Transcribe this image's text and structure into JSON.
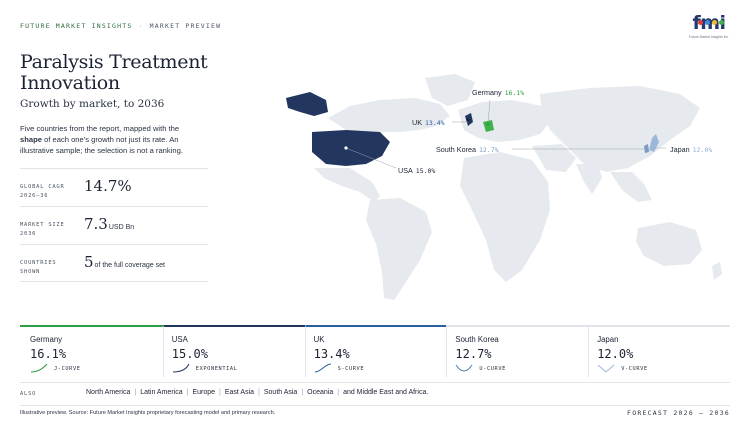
{
  "header": {
    "brand": "FUTURE MARKET INSIGHTS",
    "separator": "·",
    "section": "MARKET PREVIEW"
  },
  "logo": {
    "text": "fmi",
    "tagline": "Future Market Insights Inc.",
    "dot_colors": [
      "#e23b3b",
      "#3a8fe0",
      "#f2b632",
      "#3fb34a"
    ]
  },
  "title": "Paralysis Treatment Innovation",
  "subtitle": "Growth by market, to 2036",
  "description": {
    "before": "Five countries from the report, mapped with the ",
    "bold": "shape",
    "after": " of each one's growth not just its rate. An illustrative sample; the selection is not a ranking."
  },
  "stats": [
    {
      "label": "GLOBAL CAGR 2026–36",
      "value": "14.7%",
      "unit": ""
    },
    {
      "label": "MARKET SIZE 2036",
      "value": "7.3",
      "unit": "USD Bn"
    },
    {
      "label": "COUNTRIES SHOWN",
      "value": "5",
      "unit": "of the full coverage set"
    }
  ],
  "map": {
    "labels": [
      {
        "name": "Germany",
        "value": "16.1%",
        "color": "#2e9e45"
      },
      {
        "name": "UK",
        "value": "13.4%",
        "color": "#2a5e9c"
      },
      {
        "name": "South Korea",
        "value": "12.7%",
        "color": "#7a9bc2"
      },
      {
        "name": "Japan",
        "value": "12.0%",
        "color": "#8fb0d4"
      },
      {
        "name": "USA",
        "value": "15.0%",
        "color": "#1a2233"
      }
    ],
    "colors": {
      "land": "#e6e9ed",
      "usa": "#23365f",
      "germany": "#3fb34a",
      "uk": "#23365f",
      "accent_light": "#9bb8dc"
    }
  },
  "cards": [
    {
      "name": "Germany",
      "value": "16.1%",
      "shape": "J-CURVE",
      "accent": "#2e9e45"
    },
    {
      "name": "USA",
      "value": "15.0%",
      "shape": "EXPONENTIAL",
      "accent": "#23365f"
    },
    {
      "name": "UK",
      "value": "13.4%",
      "shape": "S-CURVE",
      "accent": "#2a5e9c"
    },
    {
      "name": "South Korea",
      "value": "12.7%",
      "shape": "U-CURVE",
      "accent": "#4a7ab5"
    },
    {
      "name": "Japan",
      "value": "12.0%",
      "shape": "V-CURVE",
      "accent": "#9bb8dc"
    }
  ],
  "also": {
    "label": "ALSO",
    "regions": [
      "North America",
      "Latin America",
      "Europe",
      "East Asia",
      "South Asia",
      "Oceania",
      "and Middle East and Africa."
    ]
  },
  "footer": {
    "source": "Illustrative preview. Source: Future Market Insights proprietary forecasting model and primary research.",
    "forecast": "FORECAST 2026 – 2036"
  }
}
